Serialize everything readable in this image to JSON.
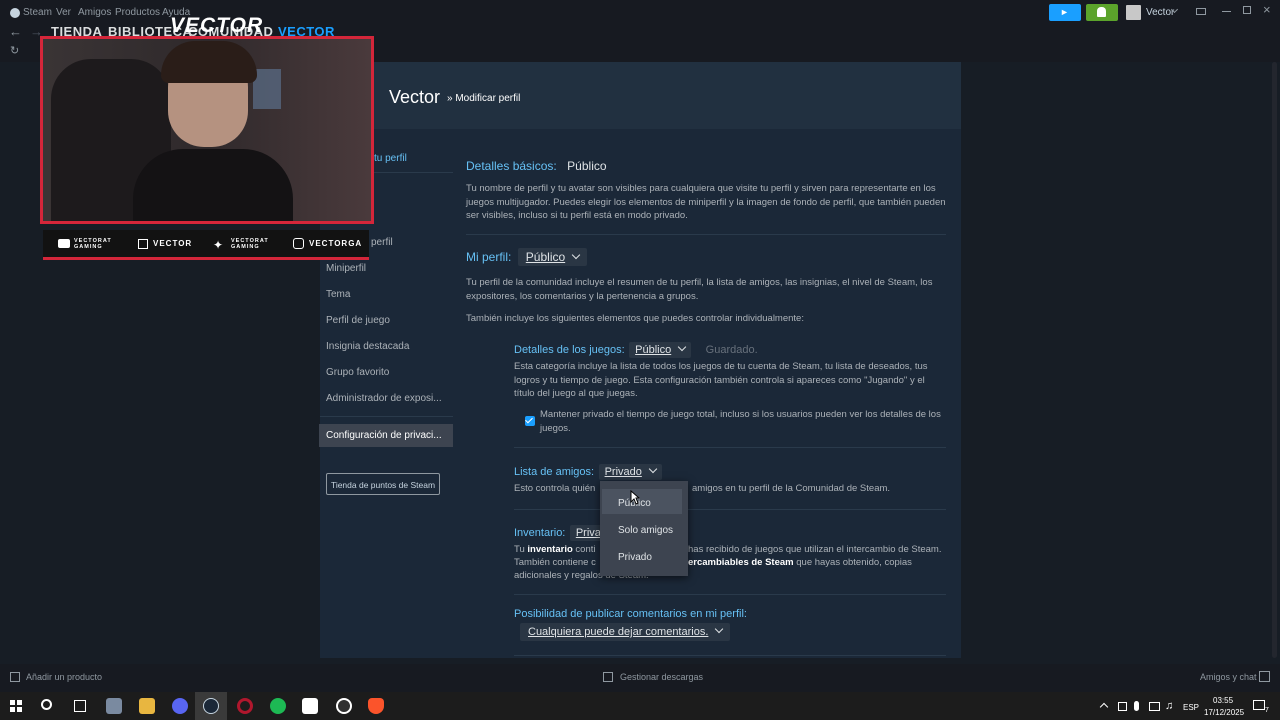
{
  "menu": {
    "app": "Steam",
    "items": [
      "Ver",
      "Amigos",
      "Productos",
      "Ayuda"
    ]
  },
  "nav": {
    "tabs": [
      "TIENDA",
      "BIBLIOTECA",
      "COMUNIDAD",
      "VECTOR"
    ]
  },
  "topright": {
    "username": "Vector"
  },
  "overlay": {
    "logo": "VECTOR",
    "socials": [
      "VECTORAT GAMING",
      "VECTOR",
      "VECTORAT GAMING",
      "VECTORGA"
    ]
  },
  "header": {
    "name": "Vector",
    "crumb": "» Modificar perfil"
  },
  "sidebar": {
    "items": [
      "tu perfil",
      "perfil",
      "Miniperfil",
      "Tema",
      "Perfil de juego",
      "Insignia destacada",
      "Grupo favorito",
      "Administrador de exposi...",
      "Configuración de privaci..."
    ],
    "points_button": "Tienda de puntos de Steam"
  },
  "basic": {
    "title": "Detalles básicos:",
    "value": "Público",
    "desc": "Tu nombre de perfil y tu avatar son visibles para cualquiera que visite tu perfil y sirven para representarte en los juegos multijugador. Puedes elegir los elementos de miniperfil y la imagen de fondo de perfil, que también pueden ser visibles, incluso si tu perfil está en modo privado."
  },
  "profile": {
    "title": "Mi perfil:",
    "value": "Público",
    "desc1": "Tu perfil de la comunidad incluye el resumen de tu perfil, la lista de amigos, las insignias, el nivel de Steam, los expositores, los comentarios y la pertenencia a grupos.",
    "desc2": "También incluye los siguientes elementos que puedes controlar individualmente:"
  },
  "games": {
    "title": "Detalles de los juegos:",
    "value": "Público",
    "saved": "Guardado.",
    "desc": "Esta categoría incluye la lista de todos los juegos de tu cuenta de Steam, tu lista de deseados, tus logros y tu tiempo de juego. Esta configuración también controla si apareces como \"Jugando\" y el título del juego al que juegas.",
    "checkbox": "Mantener privado el tiempo de juego total, incluso si los usuarios pueden ver los detalles de los juegos."
  },
  "friends": {
    "title": "Lista de amigos:",
    "value": "Privado",
    "desc_start": "Esto controla quién",
    "desc_end": "amigos en tu perfil de la Comunidad de Steam."
  },
  "inventory": {
    "title": "Inventario:",
    "value": "Priva",
    "line1_a": "Tu ",
    "line1_b": "inventario",
    "line1_c": " conti",
    "line1_d": "has recibido de juegos que utilizan el intercambio de Steam.",
    "line2_a": "También contiene c",
    "line2_b": "ercambiables de Steam",
    "line2_c": " que hayas obtenido, copias",
    "line3": "adicionales y regalos de Steam."
  },
  "comments": {
    "title": "Posibilidad de publicar comentarios en mi perfil:",
    "value": "Cualquiera puede dejar comentarios."
  },
  "dropdown": {
    "options": [
      "Público",
      "Solo amigos",
      "Privado"
    ]
  },
  "bottombar": {
    "add": "Añadir un producto",
    "downloads": "Gestionar descargas",
    "friends": "Amigos y chat"
  },
  "taskbar": {
    "lang": "ESP",
    "time": "03:55",
    "date": "17/12/2025",
    "notif": "7"
  }
}
